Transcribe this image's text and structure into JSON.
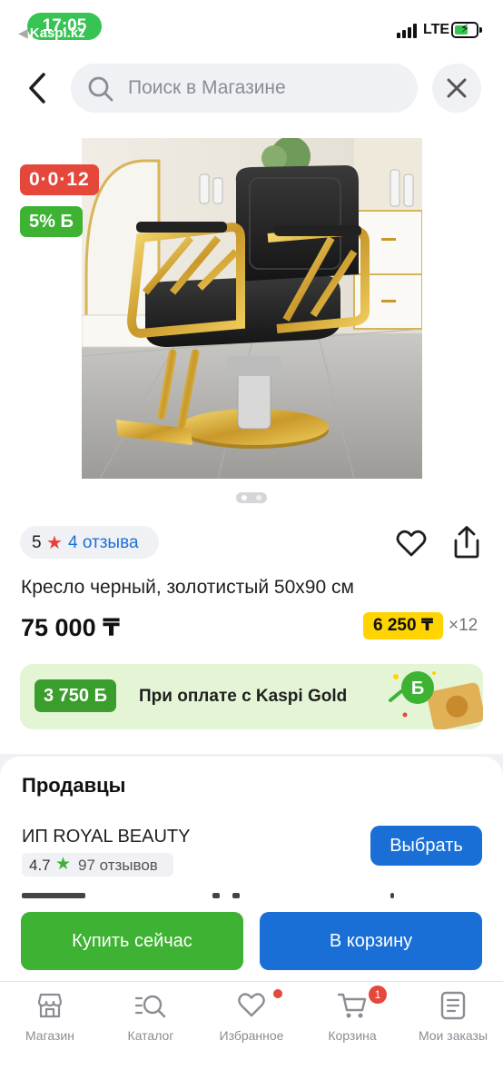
{
  "status_bar": {
    "time": "17:05",
    "back_app": "Kaspi.kz",
    "network": "LTE"
  },
  "search": {
    "placeholder": "Поиск в Магазине"
  },
  "product": {
    "badge_credit": "0·0·12",
    "badge_bonus": "5% Б",
    "image_count": 2,
    "current_image_index": 1,
    "rating": "5",
    "reviews_link": "4 отзыва",
    "title": "Кресло черный, золотистый 50x90 см",
    "price": "75 000 ₸",
    "monthly_payment": "6 250 ₸",
    "months": "×12"
  },
  "kaspi_gold": {
    "bonus": "3 750 Б",
    "text": "При оплате с Kaspi Gold",
    "art_icon": "Б"
  },
  "sellers": {
    "title": "Продавцы",
    "items": [
      {
        "name": "ИП ROYAL BEAUTY",
        "rating": "4.7",
        "reviews": "97 отзывов",
        "action": "Выбрать"
      }
    ]
  },
  "actions": {
    "buy_now": "Купить сейчас",
    "add_to_cart": "В корзину"
  },
  "tabbar": {
    "items": [
      {
        "label": "Магазин",
        "icon": "shop-icon"
      },
      {
        "label": "Каталог",
        "icon": "catalog-search-icon"
      },
      {
        "label": "Избранное",
        "icon": "heart-icon"
      },
      {
        "label": "Корзина",
        "icon": "cart-icon"
      },
      {
        "label": "Мои заказы",
        "icon": "orders-icon"
      }
    ],
    "cart_count": "1"
  },
  "colors": {
    "brand_blue": "#1a6fd6",
    "green": "#3db233",
    "red": "#e5473b",
    "yellow": "#ffd400"
  }
}
